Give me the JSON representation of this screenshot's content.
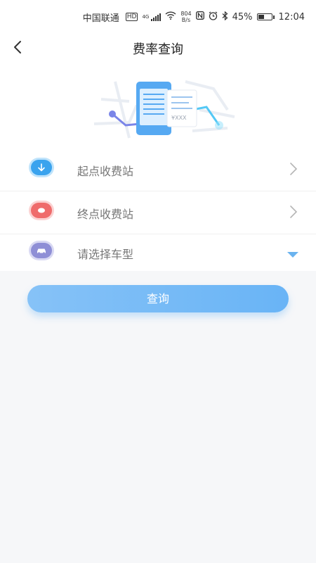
{
  "status_bar": {
    "carrier": "中国联通",
    "network_badge": "HD",
    "network_type": "4G",
    "speed_value": "804",
    "speed_unit": "B/s",
    "battery_percent": "45%",
    "battery_level": 0.45,
    "time": "12:04",
    "icons": [
      "hd-icon",
      "signal-icon",
      "wifi-icon",
      "nfc-icon",
      "alarm-icon",
      "bluetooth-icon",
      "battery-icon"
    ]
  },
  "header": {
    "title": "费率查询",
    "back_icon": "chevron-left-icon"
  },
  "illustration": {
    "receipt_text": "¥XXX"
  },
  "form": {
    "start_station": {
      "label": "起点收费站",
      "icon": "arrow-down-circle-icon",
      "color": "#4aa7ef"
    },
    "end_station": {
      "label": "终点收费站",
      "icon": "stop-circle-icon",
      "color": "#ef6b6b"
    },
    "vehicle_type": {
      "label": "请选择车型",
      "icon": "car-icon",
      "color": "#8f8fd6"
    }
  },
  "actions": {
    "query_label": "查询"
  },
  "colors": {
    "accent": "#69b4f6",
    "background": "#f6f7f9",
    "text_secondary": "#777777"
  }
}
